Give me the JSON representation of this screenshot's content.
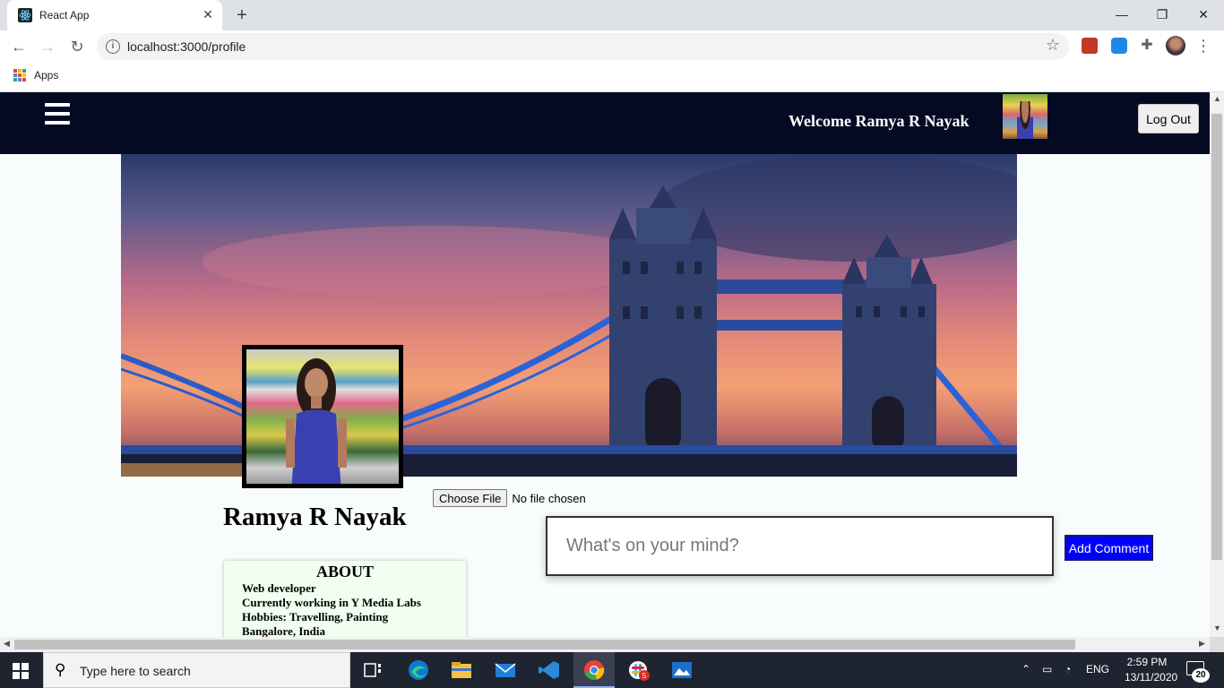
{
  "browser": {
    "tab_title": "React App",
    "tab_close": "✕",
    "new_tab": "+",
    "window_controls": {
      "minimize": "—",
      "maximize": "❐",
      "close": "✕"
    },
    "url": "localhost:3000/profile",
    "bookmarks": {
      "apps_label": "Apps"
    }
  },
  "navbar": {
    "welcome": "Welcome Ramya R Nayak",
    "logout_label": "Log Out"
  },
  "profile": {
    "choose_file_label": "Choose File",
    "no_file_text": "No file chosen",
    "name": "Ramya R Nayak",
    "post_placeholder": "What's on your mind?",
    "add_comment_label": "Add Comment",
    "about": {
      "heading": "ABOUT",
      "lines": [
        "Web developer",
        "Currently working in Y Media Labs",
        "Hobbies: Travelling, Painting",
        "Bangalore, India"
      ]
    }
  },
  "taskbar": {
    "search_placeholder": "Type here to search",
    "language": "ENG",
    "time": "2:59 PM",
    "date": "13/11/2020",
    "notification_count": "20",
    "slack_badge": "5"
  },
  "colors": {
    "navbar_bg": "#050a23",
    "add_comment_bg": "#0000ff",
    "about_bg": "#f0fff0",
    "page_bg": "#f8fcfc"
  }
}
